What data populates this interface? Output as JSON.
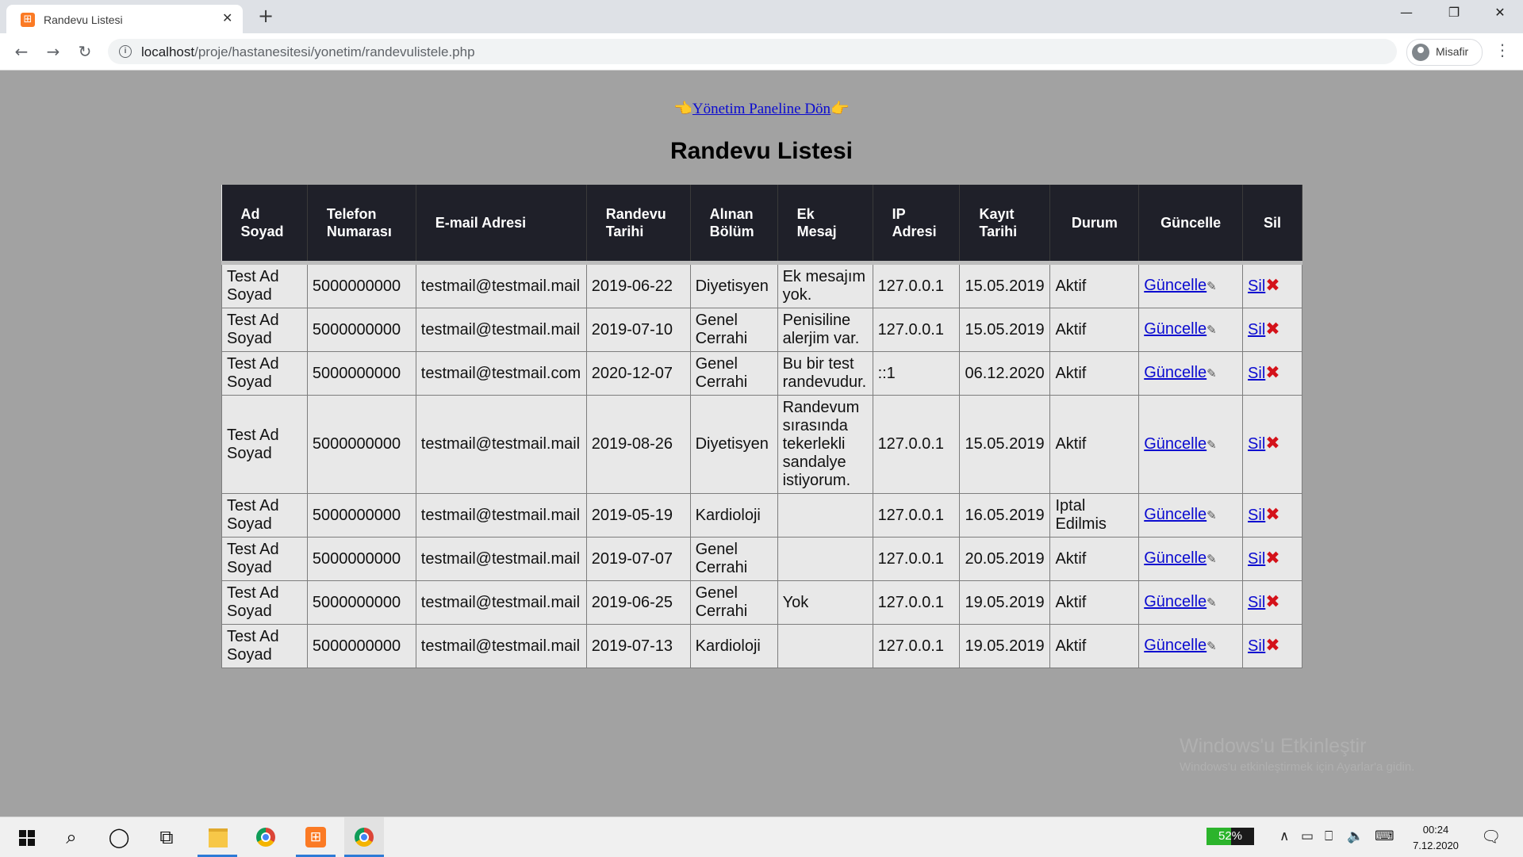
{
  "browser": {
    "tab_title": "Randevu Listesi",
    "tab_favicon": "⊞",
    "close_glyph": "✕",
    "new_tab_glyph": "+",
    "url_host": "localhost",
    "url_path": "/proje/hastanesitesi/yonetim/randevulistele.php",
    "profile_name": "Misafir",
    "back_glyph": "←",
    "forward_glyph": "→",
    "reload_glyph": "↻",
    "menu_glyph": "⋮",
    "minimize_glyph": "—",
    "restore_glyph": "❐",
    "window_close_glyph": "✕"
  },
  "page": {
    "back_link_label": "Yönetim Paneline Dön",
    "hand_left": "👈",
    "hand_right": "👉",
    "title": "Randevu Listesi"
  },
  "table": {
    "headers": {
      "ad": [
        "Ad",
        "Soyad"
      ],
      "telefon": [
        "Telefon",
        "Numarası"
      ],
      "email": "E-mail Adresi",
      "tarih": [
        "Randevu",
        "Tarihi"
      ],
      "bolum": [
        "Alınan",
        "Bölüm"
      ],
      "mesaj": [
        "Ek",
        "Mesaj"
      ],
      "ip": [
        "IP",
        "Adresi"
      ],
      "kayit": [
        "Kayıt",
        "Tarihi"
      ],
      "durum": "Durum",
      "guncelle": "Güncelle",
      "sil": "Sil"
    },
    "update_label": "Güncelle",
    "delete_label": "Sil",
    "pen_glyph": "✎",
    "x_glyph": "✖",
    "rows": [
      {
        "name": "Test Ad Soyad",
        "phone": "5000000000",
        "email": "testmail@testmail.mail",
        "date": "2019-06-22",
        "dept": "Diyetisyen",
        "msg": "Ek mesajım yok.",
        "ip": "127.0.0.1",
        "created": "15.05.2019",
        "status": "Aktif"
      },
      {
        "name": "Test Ad Soyad",
        "phone": "5000000000",
        "email": "testmail@testmail.mail",
        "date": "2019-07-10",
        "dept": "Genel Cerrahi",
        "msg": "Penisiline alerjim var.",
        "ip": "127.0.0.1",
        "created": "15.05.2019",
        "status": "Aktif"
      },
      {
        "name": "Test Ad Soyad",
        "phone": "5000000000",
        "email": "testmail@testmail.com",
        "date": "2020-12-07",
        "dept": "Genel Cerrahi",
        "msg": "Bu bir test randevudur.",
        "ip": "::1",
        "created": "06.12.2020",
        "status": "Aktif"
      },
      {
        "name": "Test Ad Soyad",
        "phone": "5000000000",
        "email": "testmail@testmail.mail",
        "date": "2019-08-26",
        "dept": "Diyetisyen",
        "msg": "Randevum sırasında tekerlekli sandalye istiyorum.",
        "ip": "127.0.0.1",
        "created": "15.05.2019",
        "status": "Aktif"
      },
      {
        "name": "Test Ad Soyad",
        "phone": "5000000000",
        "email": "testmail@testmail.mail",
        "date": "2019-05-19",
        "dept": "Kardioloji",
        "msg": "",
        "ip": "127.0.0.1",
        "created": "16.05.2019",
        "status": "Iptal Edilmis"
      },
      {
        "name": "Test Ad Soyad",
        "phone": "5000000000",
        "email": "testmail@testmail.mail",
        "date": "2019-07-07",
        "dept": "Genel Cerrahi",
        "msg": "",
        "ip": "127.0.0.1",
        "created": "20.05.2019",
        "status": "Aktif"
      },
      {
        "name": "Test Ad Soyad",
        "phone": "5000000000",
        "email": "testmail@testmail.mail",
        "date": "2019-06-25",
        "dept": "Genel Cerrahi",
        "msg": "Yok",
        "ip": "127.0.0.1",
        "created": "19.05.2019",
        "status": "Aktif"
      },
      {
        "name": "Test Ad Soyad",
        "phone": "5000000000",
        "email": "testmail@testmail.mail",
        "date": "2019-07-13",
        "dept": "Kardioloji",
        "msg": "",
        "ip": "127.0.0.1",
        "created": "19.05.2019",
        "status": "Aktif"
      }
    ]
  },
  "watermark": {
    "line1": "Windows'u Etkinleştir",
    "line2": "Windows'u etkinleştirmek için Ayarlar'a gidin."
  },
  "taskbar": {
    "search_glyph": "⌕",
    "cortana_glyph": "◯",
    "taskview_glyph": "⧉",
    "xampp_glyph": "⊞",
    "battery_percent": "52%",
    "tray_up_glyph": "∧",
    "tray_battery_glyph": "▭",
    "tray_network_glyph": "⎕",
    "tray_volume_glyph": "🔈",
    "tray_keyboard_glyph": "⌨",
    "time": "00:24",
    "date": "7.12.2020",
    "notification_glyph": "🗨",
    "colors": {
      "accent": "#2d7bd6",
      "battery": "#2cb42c"
    }
  }
}
